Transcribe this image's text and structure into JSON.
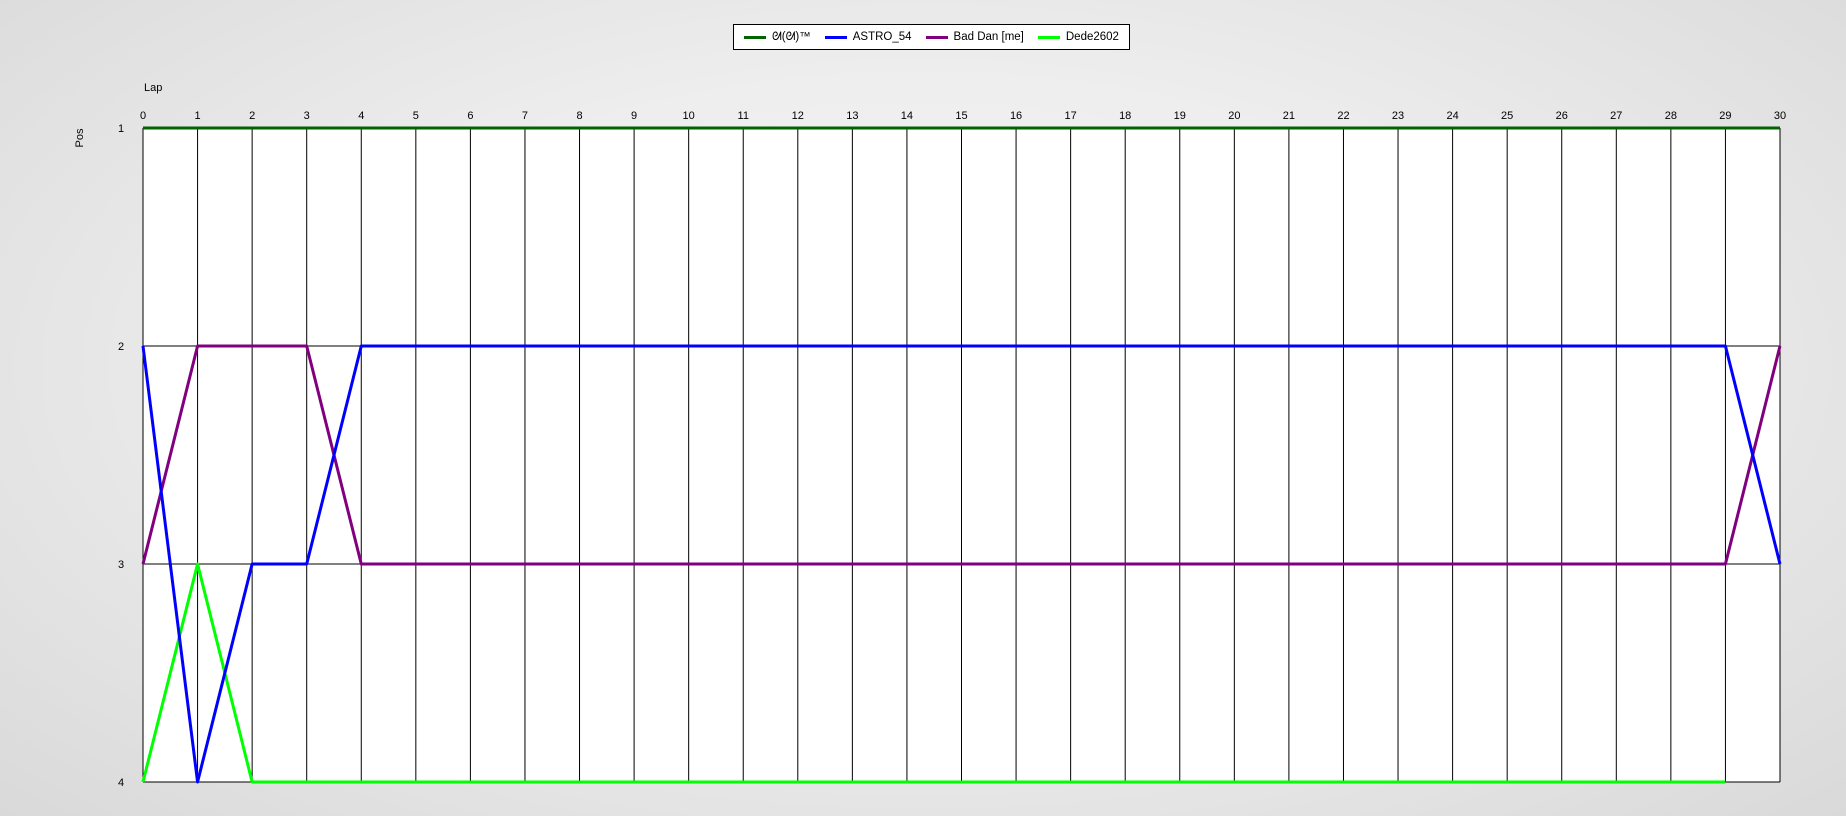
{
  "chart_data": {
    "type": "line",
    "xlabel": "Lap",
    "ylabel": "Pos",
    "x": [
      0,
      1,
      2,
      3,
      4,
      5,
      6,
      7,
      8,
      9,
      10,
      11,
      12,
      13,
      14,
      15,
      16,
      17,
      18,
      19,
      20,
      21,
      22,
      23,
      24,
      25,
      26,
      27,
      28,
      29,
      30
    ],
    "xlim": [
      0,
      30
    ],
    "y_ticks": [
      1,
      2,
      3,
      4
    ],
    "ylim": [
      1,
      4
    ],
    "y_inverted": true,
    "grid": true,
    "legend_position": "top-center",
    "series": [
      {
        "name": "ᘛ(ᘛ)™",
        "color": "#006400",
        "values": [
          1,
          1,
          1,
          1,
          1,
          1,
          1,
          1,
          1,
          1,
          1,
          1,
          1,
          1,
          1,
          1,
          1,
          1,
          1,
          1,
          1,
          1,
          1,
          1,
          1,
          1,
          1,
          1,
          1,
          1,
          1
        ]
      },
      {
        "name": "ASTRO_54",
        "color": "#0000ff",
        "values": [
          2,
          4,
          3,
          3,
          2,
          2,
          2,
          2,
          2,
          2,
          2,
          2,
          2,
          2,
          2,
          2,
          2,
          2,
          2,
          2,
          2,
          2,
          2,
          2,
          2,
          2,
          2,
          2,
          2,
          2,
          3
        ]
      },
      {
        "name": "Bad Dan [me]",
        "color": "#800080",
        "values": [
          3,
          2,
          2,
          2,
          3,
          3,
          3,
          3,
          3,
          3,
          3,
          3,
          3,
          3,
          3,
          3,
          3,
          3,
          3,
          3,
          3,
          3,
          3,
          3,
          3,
          3,
          3,
          3,
          3,
          3,
          2
        ]
      },
      {
        "name": "Dede2602",
        "color": "#00ff00",
        "values": [
          4,
          3,
          4,
          4,
          4,
          4,
          4,
          4,
          4,
          4,
          4,
          4,
          4,
          4,
          4,
          4,
          4,
          4,
          4,
          4,
          4,
          4,
          4,
          4,
          4,
          4,
          4,
          4,
          4,
          4
        ]
      }
    ]
  }
}
